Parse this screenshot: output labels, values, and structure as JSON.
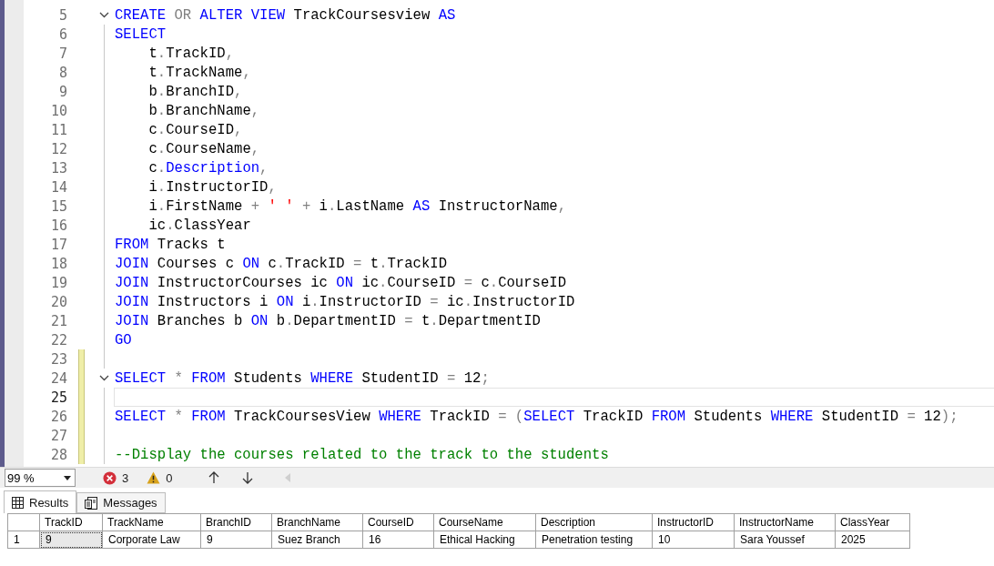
{
  "editor": {
    "lines": [
      {
        "number": "5",
        "fold": true,
        "changed": false,
        "current": false,
        "tokens": [
          {
            "kind": "kw",
            "text": "CREATE "
          },
          {
            "kind": "op",
            "text": "OR "
          },
          {
            "kind": "kw",
            "text": "ALTER VIEW "
          },
          {
            "kind": "id",
            "text": "TrackCoursesview "
          },
          {
            "kind": "kw",
            "text": "AS"
          }
        ]
      },
      {
        "number": "6",
        "fold": false,
        "changed": false,
        "current": false,
        "tokens": [
          {
            "kind": "kw",
            "text": "SELECT"
          }
        ]
      },
      {
        "number": "7",
        "fold": false,
        "changed": false,
        "current": false,
        "tokens": [
          {
            "kind": "id",
            "text": "    t"
          },
          {
            "kind": "op",
            "text": "."
          },
          {
            "kind": "id",
            "text": "TrackID"
          },
          {
            "kind": "op",
            "text": ","
          }
        ]
      },
      {
        "number": "8",
        "fold": false,
        "changed": false,
        "current": false,
        "tokens": [
          {
            "kind": "id",
            "text": "    t"
          },
          {
            "kind": "op",
            "text": "."
          },
          {
            "kind": "id",
            "text": "TrackName"
          },
          {
            "kind": "op",
            "text": ","
          }
        ]
      },
      {
        "number": "9",
        "fold": false,
        "changed": false,
        "current": false,
        "tokens": [
          {
            "kind": "id",
            "text": "    b"
          },
          {
            "kind": "op",
            "text": "."
          },
          {
            "kind": "id",
            "text": "BranchID"
          },
          {
            "kind": "op",
            "text": ","
          }
        ]
      },
      {
        "number": "10",
        "fold": false,
        "changed": false,
        "current": false,
        "tokens": [
          {
            "kind": "id",
            "text": "    b"
          },
          {
            "kind": "op",
            "text": "."
          },
          {
            "kind": "id",
            "text": "BranchName"
          },
          {
            "kind": "op",
            "text": ","
          }
        ]
      },
      {
        "number": "11",
        "fold": false,
        "changed": false,
        "current": false,
        "tokens": [
          {
            "kind": "id",
            "text": "    c"
          },
          {
            "kind": "op",
            "text": "."
          },
          {
            "kind": "id",
            "text": "CourseID"
          },
          {
            "kind": "op",
            "text": ","
          }
        ]
      },
      {
        "number": "12",
        "fold": false,
        "changed": false,
        "current": false,
        "tokens": [
          {
            "kind": "id",
            "text": "    c"
          },
          {
            "kind": "op",
            "text": "."
          },
          {
            "kind": "id",
            "text": "CourseName"
          },
          {
            "kind": "op",
            "text": ","
          }
        ]
      },
      {
        "number": "13",
        "fold": false,
        "changed": false,
        "current": false,
        "tokens": [
          {
            "kind": "id",
            "text": "    c"
          },
          {
            "kind": "op",
            "text": "."
          },
          {
            "kind": "kw",
            "text": "Description"
          },
          {
            "kind": "op",
            "text": ","
          }
        ]
      },
      {
        "number": "14",
        "fold": false,
        "changed": false,
        "current": false,
        "tokens": [
          {
            "kind": "id",
            "text": "    i"
          },
          {
            "kind": "op",
            "text": "."
          },
          {
            "kind": "id",
            "text": "InstructorID"
          },
          {
            "kind": "op",
            "text": ","
          }
        ]
      },
      {
        "number": "15",
        "fold": false,
        "changed": false,
        "current": false,
        "tokens": [
          {
            "kind": "id",
            "text": "    i"
          },
          {
            "kind": "op",
            "text": "."
          },
          {
            "kind": "id",
            "text": "FirstName "
          },
          {
            "kind": "op",
            "text": "+ "
          },
          {
            "kind": "str",
            "text": "' '"
          },
          {
            "kind": "op",
            "text": " + "
          },
          {
            "kind": "id",
            "text": "i"
          },
          {
            "kind": "op",
            "text": "."
          },
          {
            "kind": "id",
            "text": "LastName "
          },
          {
            "kind": "kw",
            "text": "AS"
          },
          {
            "kind": "id",
            "text": " InstructorName"
          },
          {
            "kind": "op",
            "text": ","
          }
        ]
      },
      {
        "number": "16",
        "fold": false,
        "changed": false,
        "current": false,
        "tokens": [
          {
            "kind": "id",
            "text": "    ic"
          },
          {
            "kind": "op",
            "text": "."
          },
          {
            "kind": "id",
            "text": "ClassYear"
          }
        ]
      },
      {
        "number": "17",
        "fold": false,
        "changed": false,
        "current": false,
        "tokens": [
          {
            "kind": "kw",
            "text": "FROM"
          },
          {
            "kind": "id",
            "text": " Tracks t"
          }
        ]
      },
      {
        "number": "18",
        "fold": false,
        "changed": false,
        "current": false,
        "tokens": [
          {
            "kind": "kw",
            "text": "JOIN"
          },
          {
            "kind": "id",
            "text": " Courses c "
          },
          {
            "kind": "kw",
            "text": "ON"
          },
          {
            "kind": "id",
            "text": " c"
          },
          {
            "kind": "op",
            "text": "."
          },
          {
            "kind": "id",
            "text": "TrackID "
          },
          {
            "kind": "op",
            "text": "="
          },
          {
            "kind": "id",
            "text": " t"
          },
          {
            "kind": "op",
            "text": "."
          },
          {
            "kind": "id",
            "text": "TrackID"
          }
        ]
      },
      {
        "number": "19",
        "fold": false,
        "changed": false,
        "current": false,
        "tokens": [
          {
            "kind": "kw",
            "text": "JOIN"
          },
          {
            "kind": "id",
            "text": " InstructorCourses ic "
          },
          {
            "kind": "kw",
            "text": "ON"
          },
          {
            "kind": "id",
            "text": " ic"
          },
          {
            "kind": "op",
            "text": "."
          },
          {
            "kind": "id",
            "text": "CourseID "
          },
          {
            "kind": "op",
            "text": "="
          },
          {
            "kind": "id",
            "text": " c"
          },
          {
            "kind": "op",
            "text": "."
          },
          {
            "kind": "id",
            "text": "CourseID"
          }
        ]
      },
      {
        "number": "20",
        "fold": false,
        "changed": false,
        "current": false,
        "tokens": [
          {
            "kind": "kw",
            "text": "JOIN"
          },
          {
            "kind": "id",
            "text": " Instructors i "
          },
          {
            "kind": "kw",
            "text": "ON"
          },
          {
            "kind": "id",
            "text": " i"
          },
          {
            "kind": "op",
            "text": "."
          },
          {
            "kind": "id",
            "text": "InstructorID "
          },
          {
            "kind": "op",
            "text": "="
          },
          {
            "kind": "id",
            "text": " ic"
          },
          {
            "kind": "op",
            "text": "."
          },
          {
            "kind": "id",
            "text": "InstructorID"
          }
        ]
      },
      {
        "number": "21",
        "fold": false,
        "changed": false,
        "current": false,
        "tokens": [
          {
            "kind": "kw",
            "text": "JOIN"
          },
          {
            "kind": "id",
            "text": " Branches b "
          },
          {
            "kind": "kw",
            "text": "ON"
          },
          {
            "kind": "id",
            "text": " b"
          },
          {
            "kind": "op",
            "text": "."
          },
          {
            "kind": "id",
            "text": "DepartmentID "
          },
          {
            "kind": "op",
            "text": "="
          },
          {
            "kind": "id",
            "text": " t"
          },
          {
            "kind": "op",
            "text": "."
          },
          {
            "kind": "id",
            "text": "DepartmentID"
          }
        ]
      },
      {
        "number": "22",
        "fold": false,
        "changed": false,
        "current": false,
        "tokens": [
          {
            "kind": "kw",
            "text": "GO"
          }
        ]
      },
      {
        "number": "23",
        "fold": false,
        "changed": true,
        "current": false
      },
      {
        "number": "24",
        "fold": true,
        "changed": true,
        "current": false,
        "tokens": [
          {
            "kind": "kw",
            "text": "SELECT "
          },
          {
            "kind": "op",
            "text": "* "
          },
          {
            "kind": "kw",
            "text": "FROM"
          },
          {
            "kind": "id",
            "text": " Students "
          },
          {
            "kind": "kw",
            "text": "WHERE"
          },
          {
            "kind": "id",
            "text": " StudentID "
          },
          {
            "kind": "op",
            "text": "="
          },
          {
            "kind": "id",
            "text": " 12"
          },
          {
            "kind": "op",
            "text": ";"
          }
        ]
      },
      {
        "number": "25",
        "fold": false,
        "changed": true,
        "current": true
      },
      {
        "number": "26",
        "fold": false,
        "changed": true,
        "current": false,
        "tokens": [
          {
            "kind": "kw",
            "text": "SELECT "
          },
          {
            "kind": "op",
            "text": "* "
          },
          {
            "kind": "kw",
            "text": "FROM"
          },
          {
            "kind": "id",
            "text": " TrackCoursesView "
          },
          {
            "kind": "kw",
            "text": "WHERE"
          },
          {
            "kind": "id",
            "text": " TrackID "
          },
          {
            "kind": "op",
            "text": "= ("
          },
          {
            "kind": "kw",
            "text": "SELECT"
          },
          {
            "kind": "id",
            "text": " TrackID "
          },
          {
            "kind": "kw",
            "text": "FROM"
          },
          {
            "kind": "id",
            "text": " Students "
          },
          {
            "kind": "kw",
            "text": "WHERE"
          },
          {
            "kind": "id",
            "text": " StudentID "
          },
          {
            "kind": "op",
            "text": "="
          },
          {
            "kind": "id",
            "text": " 12"
          },
          {
            "kind": "op",
            "text": ");"
          }
        ]
      },
      {
        "number": "27",
        "fold": false,
        "changed": true,
        "current": false
      },
      {
        "number": "28",
        "fold": false,
        "changed": true,
        "current": false,
        "tokens": [
          {
            "kind": "cm",
            "text": "--Display the courses related to the track to the students"
          }
        ]
      }
    ]
  },
  "status_bar": {
    "zoom": "99 %",
    "errors": "3",
    "warnings": "0"
  },
  "tabs": [
    {
      "label": "Results",
      "kind": "grid",
      "selected": true
    },
    {
      "label": "Messages",
      "kind": "messages",
      "selected": false
    }
  ],
  "results": {
    "columns": [
      "TrackID",
      "TrackName",
      "BranchID",
      "BranchName",
      "CourseID",
      "CourseName",
      "Description",
      "InstructorID",
      "InstructorName",
      "ClassYear"
    ],
    "rows": [
      {
        "number": "1",
        "cells": [
          {
            "text": "9",
            "focused": true
          },
          {
            "text": "Corporate Law",
            "focused": false
          },
          {
            "text": "9",
            "focused": false
          },
          {
            "text": "Suez Branch",
            "focused": false
          },
          {
            "text": "16",
            "focused": false
          },
          {
            "text": "Ethical Hacking",
            "focused": false
          },
          {
            "text": "Penetration testing",
            "focused": false
          },
          {
            "text": "10",
            "focused": false
          },
          {
            "text": "Sara Youssef",
            "focused": false
          },
          {
            "text": "2025",
            "focused": false
          }
        ]
      }
    ]
  }
}
